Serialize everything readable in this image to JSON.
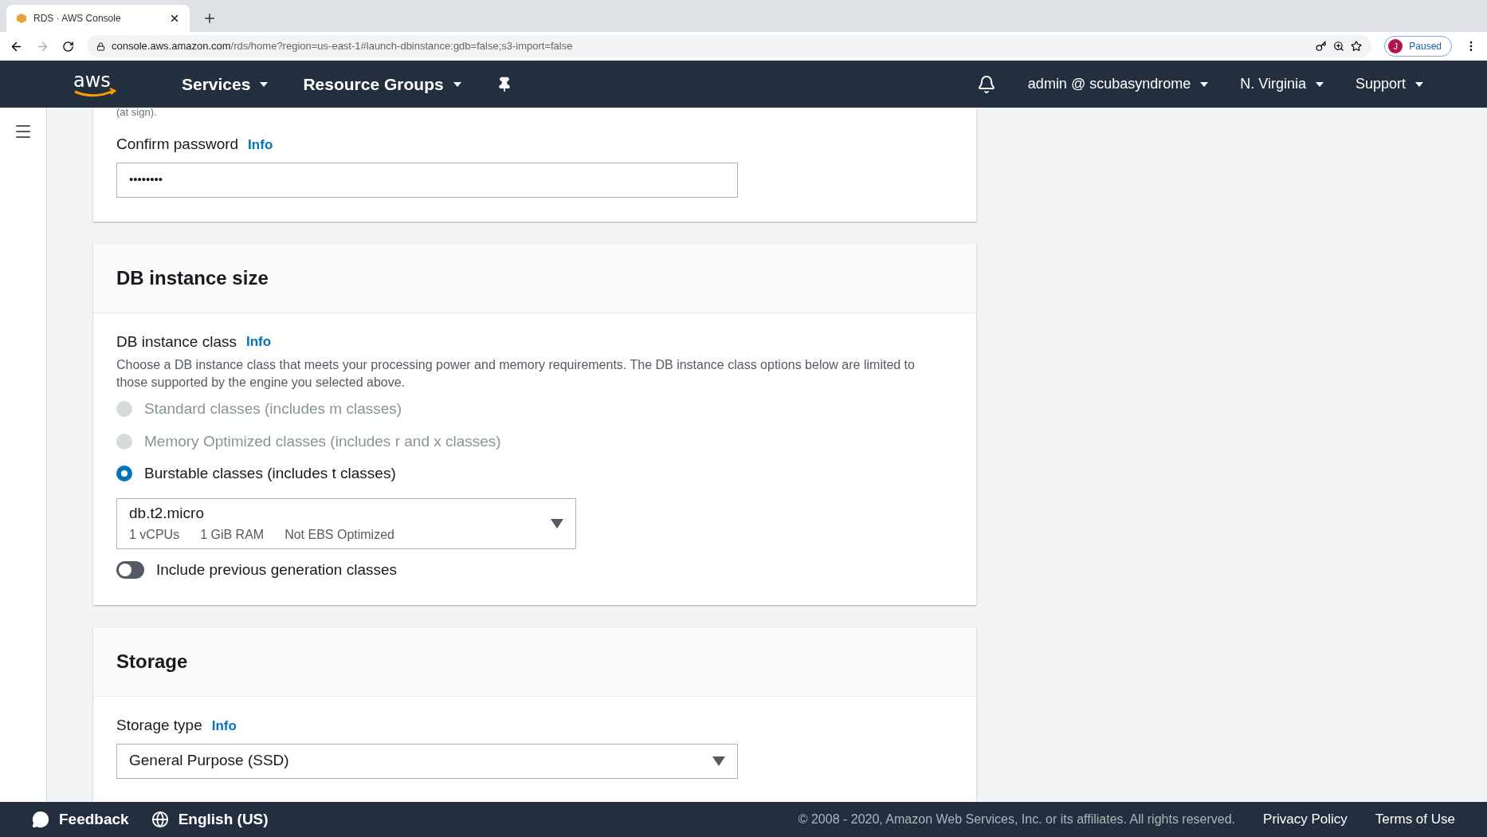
{
  "browser": {
    "tab_title": "RDS · AWS Console",
    "url_host": "console.aws.amazon.com",
    "url_path": "/rds/home?region=us-east-1#launch-dbinstance:gdb=false;s3-import=false",
    "profile_initial": "J",
    "profile_status": "Paused"
  },
  "nav": {
    "logo": "aws",
    "services": "Services",
    "resource_groups": "Resource Groups",
    "account": "admin @ scubasyndrome",
    "region": "N. Virginia",
    "support": "Support"
  },
  "password_section": {
    "hint_tail": "(at sign).",
    "confirm_label": "Confirm password",
    "info": "Info",
    "confirm_value": "••••••••"
  },
  "instance_size": {
    "title": "DB instance size",
    "class_label": "DB instance class",
    "info": "Info",
    "description": "Choose a DB instance class that meets your processing power and memory requirements. The DB instance class options below are limited to those supported by the engine you selected above.",
    "options": [
      {
        "label": "Standard classes (includes m classes)",
        "selected": false,
        "disabled": true
      },
      {
        "label": "Memory Optimized classes (includes r and x classes)",
        "selected": false,
        "disabled": true
      },
      {
        "label": "Burstable classes (includes t classes)",
        "selected": true,
        "disabled": false
      }
    ],
    "instance": {
      "name": "db.t2.micro",
      "specs": [
        "1 vCPUs",
        "1 GiB RAM",
        "Not EBS Optimized"
      ]
    },
    "toggle": {
      "label": "Include previous generation classes",
      "on": false
    }
  },
  "storage": {
    "title": "Storage",
    "type_label": "Storage type",
    "info": "Info",
    "type_value": "General Purpose (SSD)"
  },
  "footer": {
    "feedback": "Feedback",
    "language": "English (US)",
    "copyright": "© 2008 - 2020, Amazon Web Services, Inc. or its affiliates. All rights reserved.",
    "links": [
      "Privacy Policy",
      "Terms of Use"
    ]
  }
}
